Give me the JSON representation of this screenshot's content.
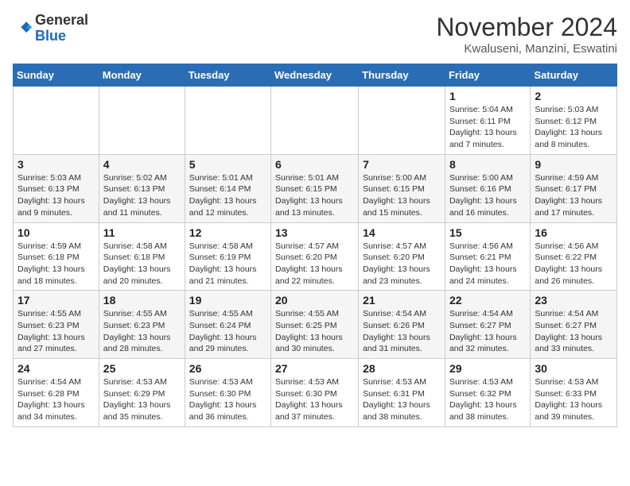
{
  "header": {
    "logo_general": "General",
    "logo_blue": "Blue",
    "month": "November 2024",
    "location": "Kwaluseni, Manzini, Eswatini"
  },
  "weekdays": [
    "Sunday",
    "Monday",
    "Tuesday",
    "Wednesday",
    "Thursday",
    "Friday",
    "Saturday"
  ],
  "weeks": [
    [
      {
        "day": "",
        "info": ""
      },
      {
        "day": "",
        "info": ""
      },
      {
        "day": "",
        "info": ""
      },
      {
        "day": "",
        "info": ""
      },
      {
        "day": "",
        "info": ""
      },
      {
        "day": "1",
        "info": "Sunrise: 5:04 AM\nSunset: 6:11 PM\nDaylight: 13 hours and 7 minutes."
      },
      {
        "day": "2",
        "info": "Sunrise: 5:03 AM\nSunset: 6:12 PM\nDaylight: 13 hours and 8 minutes."
      }
    ],
    [
      {
        "day": "3",
        "info": "Sunrise: 5:03 AM\nSunset: 6:13 PM\nDaylight: 13 hours and 9 minutes."
      },
      {
        "day": "4",
        "info": "Sunrise: 5:02 AM\nSunset: 6:13 PM\nDaylight: 13 hours and 11 minutes."
      },
      {
        "day": "5",
        "info": "Sunrise: 5:01 AM\nSunset: 6:14 PM\nDaylight: 13 hours and 12 minutes."
      },
      {
        "day": "6",
        "info": "Sunrise: 5:01 AM\nSunset: 6:15 PM\nDaylight: 13 hours and 13 minutes."
      },
      {
        "day": "7",
        "info": "Sunrise: 5:00 AM\nSunset: 6:15 PM\nDaylight: 13 hours and 15 minutes."
      },
      {
        "day": "8",
        "info": "Sunrise: 5:00 AM\nSunset: 6:16 PM\nDaylight: 13 hours and 16 minutes."
      },
      {
        "day": "9",
        "info": "Sunrise: 4:59 AM\nSunset: 6:17 PM\nDaylight: 13 hours and 17 minutes."
      }
    ],
    [
      {
        "day": "10",
        "info": "Sunrise: 4:59 AM\nSunset: 6:18 PM\nDaylight: 13 hours and 18 minutes."
      },
      {
        "day": "11",
        "info": "Sunrise: 4:58 AM\nSunset: 6:18 PM\nDaylight: 13 hours and 20 minutes."
      },
      {
        "day": "12",
        "info": "Sunrise: 4:58 AM\nSunset: 6:19 PM\nDaylight: 13 hours and 21 minutes."
      },
      {
        "day": "13",
        "info": "Sunrise: 4:57 AM\nSunset: 6:20 PM\nDaylight: 13 hours and 22 minutes."
      },
      {
        "day": "14",
        "info": "Sunrise: 4:57 AM\nSunset: 6:20 PM\nDaylight: 13 hours and 23 minutes."
      },
      {
        "day": "15",
        "info": "Sunrise: 4:56 AM\nSunset: 6:21 PM\nDaylight: 13 hours and 24 minutes."
      },
      {
        "day": "16",
        "info": "Sunrise: 4:56 AM\nSunset: 6:22 PM\nDaylight: 13 hours and 26 minutes."
      }
    ],
    [
      {
        "day": "17",
        "info": "Sunrise: 4:55 AM\nSunset: 6:23 PM\nDaylight: 13 hours and 27 minutes."
      },
      {
        "day": "18",
        "info": "Sunrise: 4:55 AM\nSunset: 6:23 PM\nDaylight: 13 hours and 28 minutes."
      },
      {
        "day": "19",
        "info": "Sunrise: 4:55 AM\nSunset: 6:24 PM\nDaylight: 13 hours and 29 minutes."
      },
      {
        "day": "20",
        "info": "Sunrise: 4:55 AM\nSunset: 6:25 PM\nDaylight: 13 hours and 30 minutes."
      },
      {
        "day": "21",
        "info": "Sunrise: 4:54 AM\nSunset: 6:26 PM\nDaylight: 13 hours and 31 minutes."
      },
      {
        "day": "22",
        "info": "Sunrise: 4:54 AM\nSunset: 6:27 PM\nDaylight: 13 hours and 32 minutes."
      },
      {
        "day": "23",
        "info": "Sunrise: 4:54 AM\nSunset: 6:27 PM\nDaylight: 13 hours and 33 minutes."
      }
    ],
    [
      {
        "day": "24",
        "info": "Sunrise: 4:54 AM\nSunset: 6:28 PM\nDaylight: 13 hours and 34 minutes."
      },
      {
        "day": "25",
        "info": "Sunrise: 4:53 AM\nSunset: 6:29 PM\nDaylight: 13 hours and 35 minutes."
      },
      {
        "day": "26",
        "info": "Sunrise: 4:53 AM\nSunset: 6:30 PM\nDaylight: 13 hours and 36 minutes."
      },
      {
        "day": "27",
        "info": "Sunrise: 4:53 AM\nSunset: 6:30 PM\nDaylight: 13 hours and 37 minutes."
      },
      {
        "day": "28",
        "info": "Sunrise: 4:53 AM\nSunset: 6:31 PM\nDaylight: 13 hours and 38 minutes."
      },
      {
        "day": "29",
        "info": "Sunrise: 4:53 AM\nSunset: 6:32 PM\nDaylight: 13 hours and 38 minutes."
      },
      {
        "day": "30",
        "info": "Sunrise: 4:53 AM\nSunset: 6:33 PM\nDaylight: 13 hours and 39 minutes."
      }
    ]
  ]
}
